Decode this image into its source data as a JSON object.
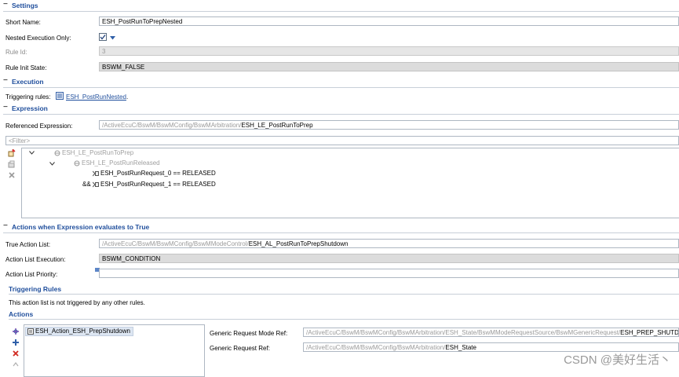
{
  "sections": {
    "settings": "Settings",
    "execution": "Execution",
    "expression": "Expression",
    "actions_when": "Actions when Expression evaluates to True"
  },
  "settings": {
    "short_name_label": "Short Name:",
    "short_name_value": "ESH_PostRunToPrepNested",
    "nested_label": "Nested Execution Only:",
    "rule_id_label": "Rule Id:",
    "rule_id_value": "3",
    "rule_init_label": "Rule Init State:",
    "rule_init_value": "BSWM_FALSE"
  },
  "execution": {
    "triggering_label": "Triggering rules:",
    "triggering_link": "ESH_PostRunNested",
    "triggering_suffix": "."
  },
  "expression": {
    "ref_label": "Referenced Expression:",
    "ref_prefix": "/ActiveEcuC/BswM/BswMConfig/BswMArbitration/",
    "ref_value": "ESH_LE_PostRunToPrep",
    "filter_placeholder": "<Filter>",
    "tree": {
      "root": "ESH_LE_PostRunToPrep",
      "child": "ESH_LE_PostRunReleased",
      "leaf1": "ESH_PostRunRequest_0 == RELEASED",
      "leaf2_op": "&&",
      "leaf2": "ESH_PostRunRequest_1 == RELEASED"
    }
  },
  "actions": {
    "true_list_label": "True Action List:",
    "true_list_prefix": "/ActiveEcuC/BswM/BswMConfig/BswMModeControl/",
    "true_list_value": "ESH_AL_PostRunToPrepShutdown",
    "exec_label": "Action List Execution:",
    "exec_value": "BSWM_CONDITION",
    "priority_label": "Action List Priority:",
    "triggering_rules_title": "Triggering Rules",
    "triggering_rules_text": "This action list is not triggered by any other rules.",
    "actions_title": "Actions",
    "action_item": "ESH_Action_ESH_PrepShutdown",
    "gen_mode_label": "Generic Request Mode Ref:",
    "gen_mode_prefix": "/ActiveEcuC/BswM/BswMConfig/BswMArbitration/ESH_State/BswMModeRequestSource/BswMGenericRequest/",
    "gen_mode_value": "ESH_PREP_SHUTDOWN",
    "gen_ref_label": "Generic Request Ref:",
    "gen_ref_prefix": "/ActiveEcuC/BswM/BswMConfig/BswMArbitration/",
    "gen_ref_value": "ESH_State"
  },
  "watermark": "CSDN @美好生活丶",
  "colors": {
    "section_title": "#1f4e9c",
    "readonly_bg": "#e6e6e6",
    "selected_item_bg": "#dde6f2"
  }
}
